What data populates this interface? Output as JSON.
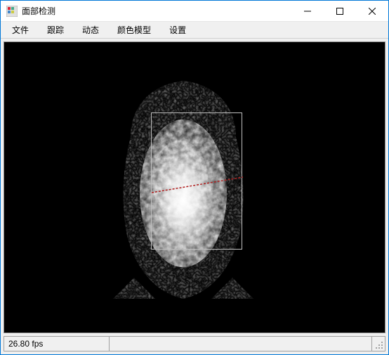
{
  "window": {
    "title": "面部检测"
  },
  "menu": {
    "items": [
      {
        "label": "文件"
      },
      {
        "label": "跟踪"
      },
      {
        "label": "动态"
      },
      {
        "label": "颜色模型"
      },
      {
        "label": "设置"
      }
    ]
  },
  "status": {
    "fps_text": "26.80 fps"
  },
  "detection": {
    "bbox_visible": true
  }
}
